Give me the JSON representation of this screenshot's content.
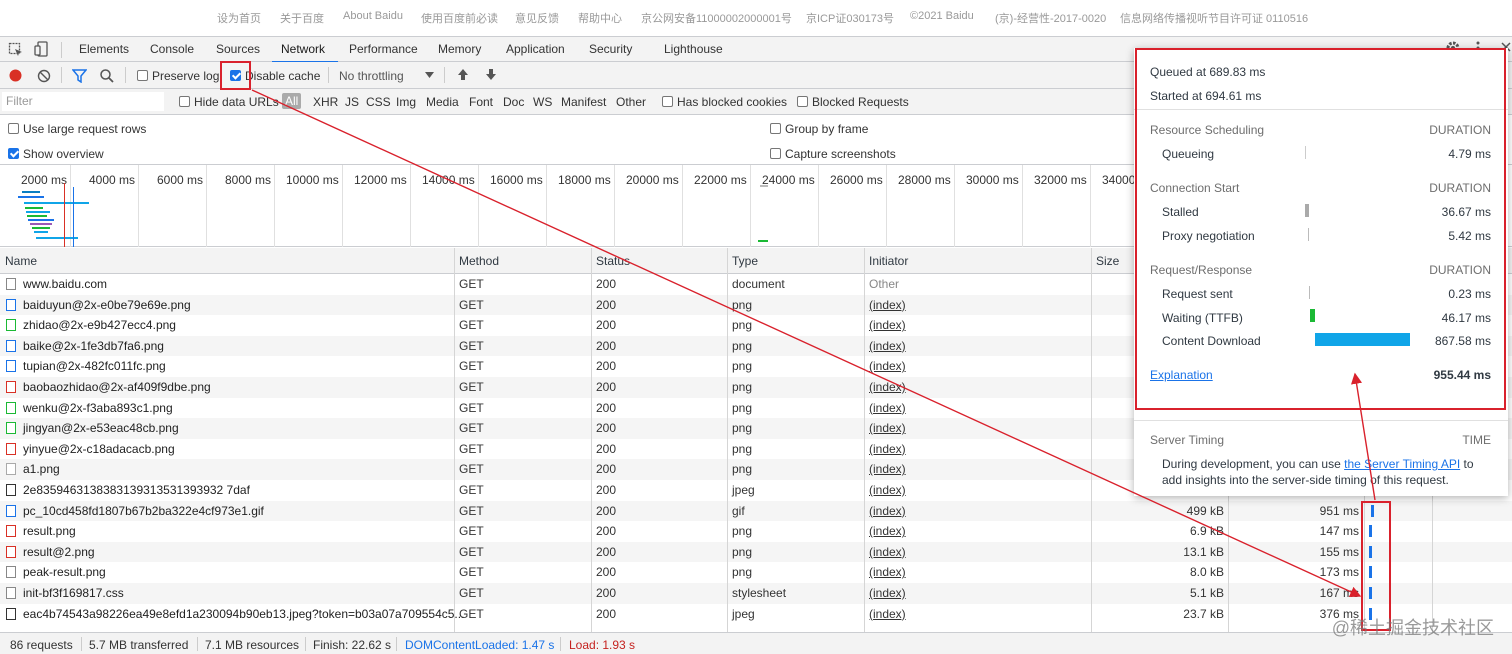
{
  "page_footer_links": [
    "设为首页",
    "关于百度",
    "About Baidu",
    "使用百度前必读",
    "意见反馈",
    "帮助中心",
    "京公网安备11000002000001号",
    "京ICP证030173号",
    "©2021 Baidu",
    "(京)-经营性-2017-0020",
    "信息网络传播视听节目许可证 0110516"
  ],
  "devtools": {
    "tabs": [
      "Elements",
      "Console",
      "Sources",
      "Network",
      "Performance",
      "Memory",
      "Application",
      "Security",
      "Lighthouse"
    ],
    "active_tab": "Network"
  },
  "toolbar": {
    "preserve_log": "Preserve log",
    "disable_cache": "Disable cache",
    "disable_cache_checked": true,
    "throttling": "No throttling"
  },
  "filterbar": {
    "placeholder": "Filter",
    "hide_data_urls": "Hide data URLs",
    "types": [
      "All",
      "XHR",
      "JS",
      "CSS",
      "Img",
      "Media",
      "Font",
      "Doc",
      "WS",
      "Manifest",
      "Other"
    ],
    "has_blocked_cookies": "Has blocked cookies",
    "blocked_requests": "Blocked Requests"
  },
  "settings": {
    "large_rows": "Use large request rows",
    "show_overview": "Show overview",
    "group_by_frame": "Group by frame",
    "capture_screenshots": "Capture screenshots"
  },
  "overview_ticks": [
    "2000 ms",
    "4000 ms",
    "6000 ms",
    "8000 ms",
    "10000 ms",
    "12000 ms",
    "14000 ms",
    "16000 ms",
    "18000 ms",
    "20000 ms",
    "22000 ms",
    "24000 ms",
    "26000 ms",
    "28000 ms",
    "30000 ms",
    "32000 ms",
    "34000"
  ],
  "table": {
    "headers": [
      "Name",
      "Method",
      "Status",
      "Type",
      "Initiator",
      "Size"
    ],
    "rows": [
      {
        "name": "www.baidu.com",
        "method": "GET",
        "status": "200",
        "type": "document",
        "initiator": "Other",
        "size": "",
        "time": ""
      },
      {
        "name": "baiduyun@2x-e0be79e69e.png",
        "method": "GET",
        "status": "200",
        "type": "png",
        "initiator": "(index)",
        "size": "",
        "time": ""
      },
      {
        "name": "zhidao@2x-e9b427ecc4.png",
        "method": "GET",
        "status": "200",
        "type": "png",
        "initiator": "(index)",
        "size": "",
        "time": ""
      },
      {
        "name": "baike@2x-1fe3db7fa6.png",
        "method": "GET",
        "status": "200",
        "type": "png",
        "initiator": "(index)",
        "size": "",
        "time": ""
      },
      {
        "name": "tupian@2x-482fc011fc.png",
        "method": "GET",
        "status": "200",
        "type": "png",
        "initiator": "(index)",
        "size": "",
        "time": ""
      },
      {
        "name": "baobaozhidao@2x-af409f9dbe.png",
        "method": "GET",
        "status": "200",
        "type": "png",
        "initiator": "(index)",
        "size": "",
        "time": ""
      },
      {
        "name": "wenku@2x-f3aba893c1.png",
        "method": "GET",
        "status": "200",
        "type": "png",
        "initiator": "(index)",
        "size": "",
        "time": ""
      },
      {
        "name": "jingyan@2x-e53eac48cb.png",
        "method": "GET",
        "status": "200",
        "type": "png",
        "initiator": "(index)",
        "size": "",
        "time": ""
      },
      {
        "name": "yinyue@2x-c18adacacb.png",
        "method": "GET",
        "status": "200",
        "type": "png",
        "initiator": "(index)",
        "size": "",
        "time": ""
      },
      {
        "name": "a1.png",
        "method": "GET",
        "status": "200",
        "type": "png",
        "initiator": "(index)",
        "size": "",
        "time": ""
      },
      {
        "name": "2e8359463138383139313531393932 7daf",
        "method": "GET",
        "status": "200",
        "type": "jpeg",
        "initiator": "(index)",
        "size": "",
        "time": ""
      },
      {
        "name": "pc_10cd458fd1807b67b2ba322e4cf973e1.gif",
        "method": "GET",
        "status": "200",
        "type": "gif",
        "initiator": "(index)",
        "size": "499 kB",
        "time": "951 ms"
      },
      {
        "name": "result.png",
        "method": "GET",
        "status": "200",
        "type": "png",
        "initiator": "(index)",
        "size": "6.9 kB",
        "time": "147 ms"
      },
      {
        "name": "result@2.png",
        "method": "GET",
        "status": "200",
        "type": "png",
        "initiator": "(index)",
        "size": "13.1 kB",
        "time": "155 ms"
      },
      {
        "name": "peak-result.png",
        "method": "GET",
        "status": "200",
        "type": "png",
        "initiator": "(index)",
        "size": "8.0 kB",
        "time": "173 ms"
      },
      {
        "name": "init-bf3f169817.css",
        "method": "GET",
        "status": "200",
        "type": "stylesheet",
        "initiator": "(index)",
        "size": "5.1 kB",
        "time": "167 ms"
      },
      {
        "name": "eac4b74543a98226ea49e8efd1a230094b90eb13.jpeg?token=b03a07a709554c5...",
        "method": "GET",
        "status": "200",
        "type": "jpeg",
        "initiator": "(index)",
        "size": "23.7 kB",
        "time": "376 ms"
      }
    ]
  },
  "statusbar": {
    "requests": "86 requests",
    "transferred": "5.7 MB transferred",
    "resources": "7.1 MB resources",
    "finish": "Finish: 22.62 s",
    "dom_content_loaded": "DOMContentLoaded: 1.47 s",
    "load": "Load: 1.93 s"
  },
  "timing_popup": {
    "queued_at": "Queued at 689.83 ms",
    "started_at": "Started at 694.61 ms",
    "resource_scheduling": "Resource Scheduling",
    "duration": "DURATION",
    "queueing": "Queueing",
    "queueing_value": "4.79 ms",
    "connection_start": "Connection Start",
    "stalled": "Stalled",
    "stalled_value": "36.67 ms",
    "proxy_negotiation": "Proxy negotiation",
    "proxy_negotiation_value": "5.42 ms",
    "request_response": "Request/Response",
    "request_sent": "Request sent",
    "request_sent_value": "0.23 ms",
    "waiting_ttfb": "Waiting (TTFB)",
    "waiting_ttfb_value": "46.17 ms",
    "content_download": "Content Download",
    "content_download_value": "867.58 ms",
    "explanation": "Explanation",
    "total": "955.44 ms",
    "server_timing": "Server Timing",
    "time": "TIME",
    "server_timing_text_1": "During development, you can use ",
    "server_timing_link": "the Server Timing API",
    "server_timing_text_2": " to",
    "server_timing_text_3": "add insights into the server-side timing of this request."
  },
  "watermark": "@稀土掘金技术社区",
  "colors": {
    "accent": "#1a73e8",
    "annotation_red": "#d9212c",
    "ttfb_green": "#1bb935",
    "download_blue": "#10a5e8"
  }
}
